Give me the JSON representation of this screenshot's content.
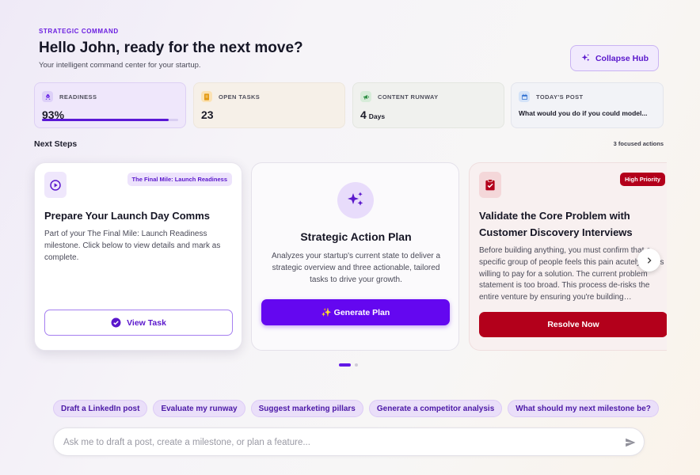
{
  "header": {
    "eyebrow": "STRATEGIC COMMAND",
    "title": "Hello John, ready for the next move?",
    "subtitle": "Your intelligent command center for your startup.",
    "collapse_label": "Collapse Hub"
  },
  "stats": {
    "readiness": {
      "label": "READINESS",
      "value": "93%",
      "progress": 0.93,
      "icon": "rocket-icon"
    },
    "open_tasks": {
      "label": "OPEN TASKS",
      "value": "23",
      "icon": "document-icon"
    },
    "content_runway": {
      "label": "CONTENT RUNWAY",
      "value": "4",
      "unit": "Days",
      "icon": "megaphone-icon"
    },
    "todays_post": {
      "label": "TODAY'S POST",
      "value": "What would you do if you could model...",
      "icon": "calendar-icon"
    }
  },
  "next_steps": {
    "title": "Next Steps",
    "count": "3 focused actions",
    "cards": [
      {
        "tag": "The Final Mile: Launch Readiness",
        "title": "Prepare Your Launch Day Comms",
        "body": "Part of your The Final Mile: Launch Readiness milestone. Click below to view details and mark as complete.",
        "button": "View Task",
        "icon": "play-circle-icon"
      },
      {
        "title": "Strategic Action Plan",
        "body": "Analyzes your startup's current state to deliver a strategic overview and three actionable, tailored tasks to drive your growth.",
        "button": "✨ Generate Plan",
        "icon": "sparkles-icon"
      },
      {
        "tag": "High Priority",
        "title": "Validate the Core Problem with Customer Discovery Interviews",
        "body": "Before building anything, you must confirm that a specific group of people feels this pain acutely and is willing to pay for a solution. The current problem statement is too broad. This process de-risks the entire venture by ensuring you're building…",
        "button": "Resolve Now",
        "icon": "clipboard-check-icon"
      }
    ]
  },
  "carousel": {
    "pages": 2,
    "active": 0
  },
  "suggestions": [
    "Draft a LinkedIn post",
    "Evaluate my runway",
    "Suggest marketing pillars",
    "Generate a competitor analysis",
    "What should my next milestone be?"
  ],
  "composer": {
    "placeholder": "Ask me to draft a post, create a milestone, or plan a feature..."
  },
  "colors": {
    "accent": "#6a1de0",
    "danger": "#b3001b",
    "chip_bg": "#eadff9"
  }
}
